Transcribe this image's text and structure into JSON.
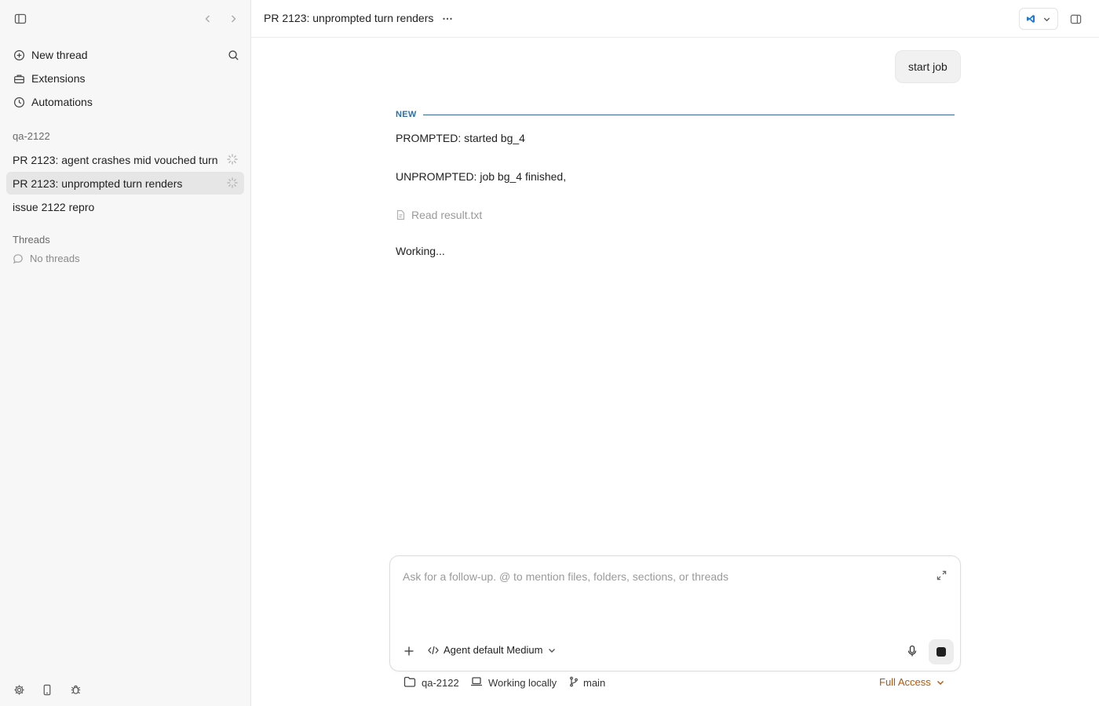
{
  "sidebar": {
    "nav": [
      {
        "label": "New thread",
        "icon": "plus-circle-icon"
      },
      {
        "label": "Extensions",
        "icon": "toolbox-icon"
      },
      {
        "label": "Automations",
        "icon": "clock-icon"
      }
    ],
    "project": {
      "name": "qa-2122",
      "threads": [
        {
          "title": "PR 2123: agent crashes mid vouched turn",
          "running": true,
          "selected": false
        },
        {
          "title": "PR 2123: unprompted turn renders",
          "running": true,
          "selected": true
        },
        {
          "title": "issue 2122 repro",
          "running": false,
          "selected": false
        }
      ]
    },
    "threads_section": {
      "label": "Threads",
      "empty_text": "No threads"
    }
  },
  "header": {
    "title": "PR 2123: unprompted turn renders",
    "more_label": "···"
  },
  "conversation": {
    "user_message": "start job",
    "divider_label": "NEW",
    "prompted_line": "PROMPTED: started bg_4",
    "unprompted_line": "UNPROMPTED: job bg_4 finished,",
    "tool_call": "Read result.txt",
    "status": "Working..."
  },
  "composer": {
    "placeholder": "Ask for a follow-up. @ to mention files, folders, sections, or threads",
    "value": "",
    "mode_label": "Agent default Medium"
  },
  "footer": {
    "folder": "qa-2122",
    "environment": "Working locally",
    "branch": "main",
    "access": "Full Access"
  },
  "colors": {
    "accent_blue": "#2f6fa3",
    "access_orange": "#b4560d",
    "selected_bg": "#e6e6e6",
    "sidebar_bg": "#f7f7f7"
  }
}
